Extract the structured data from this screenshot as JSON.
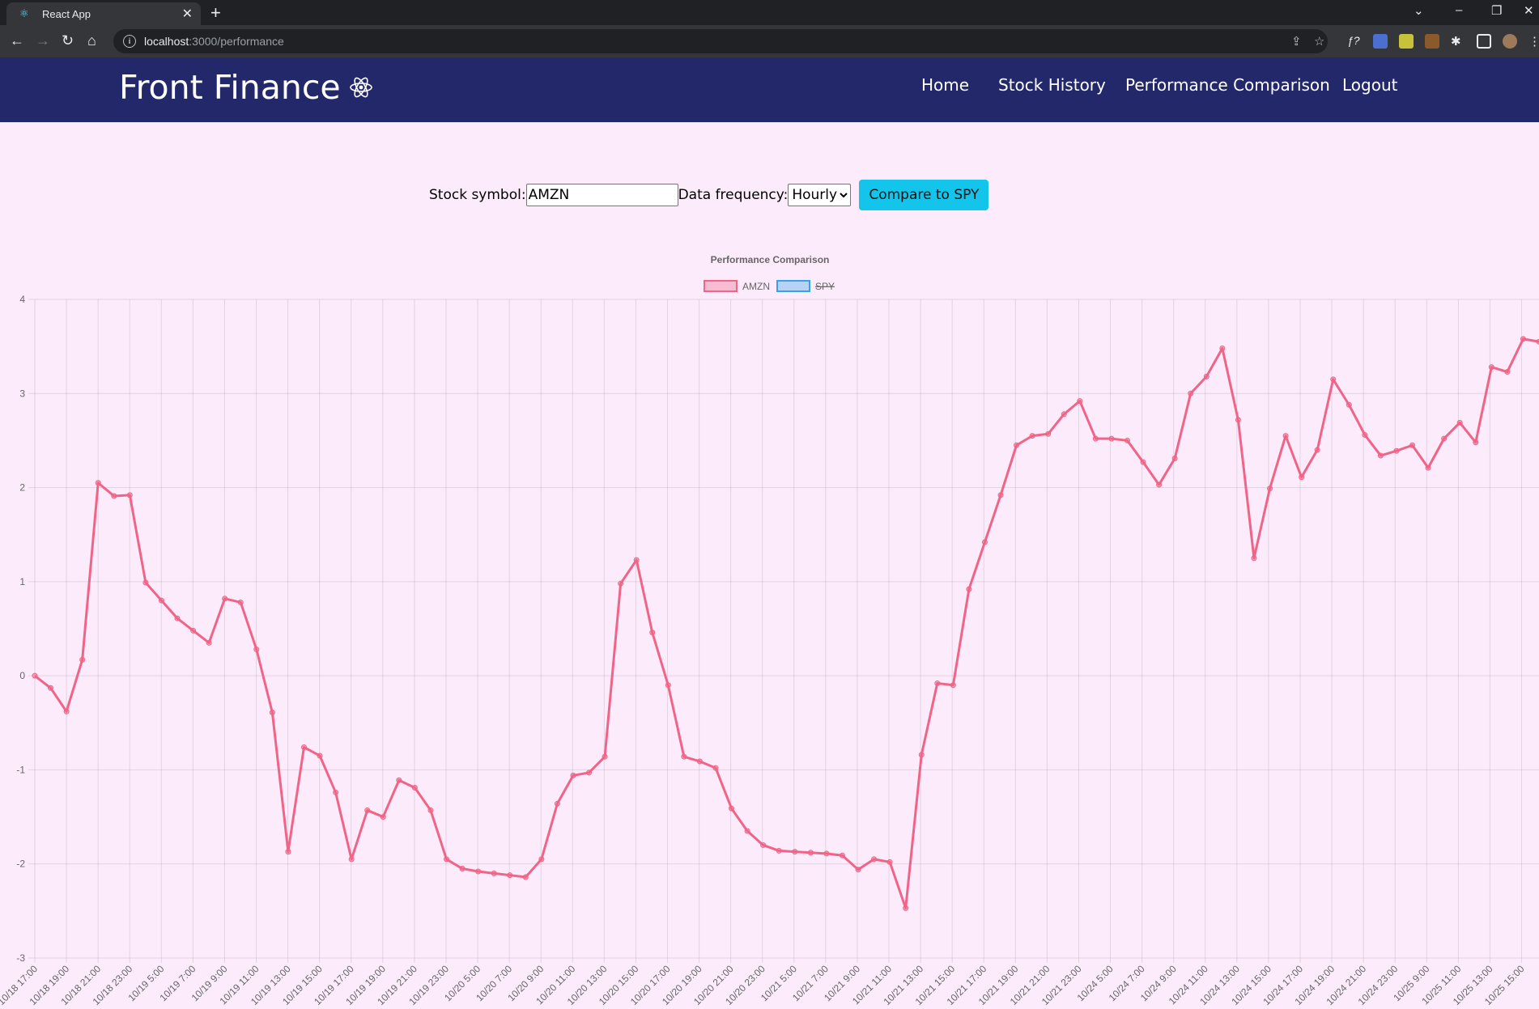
{
  "browser": {
    "tab_title": "React App",
    "url_host": "localhost",
    "url_rest": ":3000/performance"
  },
  "app": {
    "brand": "Front Finance",
    "nav": [
      "Home",
      "Stock History",
      "Performance Comparison",
      "Logout"
    ]
  },
  "form": {
    "symbol_label": "Stock symbol:",
    "symbol_value": "AMZN",
    "frequency_label": "Data frequency:",
    "frequency_selected": "Hourly",
    "compare_button": "Compare to SPY"
  },
  "colors": {
    "header_bg": "#23286b",
    "page_bg": "#fcebfb",
    "button_bg": "#13c5ea",
    "amzn_line": "#f06487",
    "spy_line": "#36a2eb"
  },
  "chart_data": {
    "type": "line",
    "title": "Performance Comparison",
    "legend": "top-center",
    "grid": true,
    "ylim": [
      -3,
      4
    ],
    "yticks": [
      -3,
      -2,
      -1,
      0,
      1,
      2,
      3,
      4
    ],
    "series": [
      {
        "name": "AMZN",
        "hidden": false,
        "values": [
          0,
          -0.13,
          -0.38,
          0.17,
          2.05,
          1.91,
          1.92,
          0.99,
          0.8,
          0.61,
          0.48,
          0.35,
          0.82,
          0.78,
          0.28,
          -0.39,
          -1.87,
          -0.76,
          -0.85,
          -1.24,
          -1.95,
          -1.43,
          -1.5,
          -1.11,
          -1.19,
          -1.43,
          -1.95,
          -2.05,
          -2.08,
          -2.1,
          -2.12,
          -2.14,
          -1.95,
          -1.36,
          -1.06,
          -1.03,
          -0.86,
          0.98,
          1.23,
          0.46,
          -0.1,
          -0.86,
          -0.91,
          -0.98,
          -1.41,
          -1.65,
          -1.8,
          -1.86,
          -1.87,
          -1.88,
          -1.89,
          -1.91,
          -2.06,
          -1.95,
          -1.98,
          -2.47,
          -0.84,
          -0.08,
          -0.1,
          0.92,
          1.42,
          1.92,
          2.45,
          2.55,
          2.57,
          2.78,
          2.92,
          2.52,
          2.52,
          2.5,
          2.27,
          2.03,
          2.31,
          3.0,
          3.18,
          3.48,
          2.72,
          1.25,
          1.99,
          2.55,
          2.11,
          2.4,
          3.15,
          2.88,
          2.56,
          2.34,
          2.39,
          2.45,
          2.21,
          2.52,
          2.69,
          2.48,
          3.28,
          3.23,
          3.58,
          3.55
        ]
      },
      {
        "name": "SPY",
        "hidden": true,
        "values": []
      }
    ],
    "x_tick_labels": [
      "10/18 17:00",
      "10/18 19:00",
      "10/18 21:00",
      "10/18 23:00",
      "10/19 5:00",
      "10/19 7:00",
      "10/19 9:00",
      "10/19 11:00",
      "10/19 13:00",
      "10/19 15:00",
      "10/19 17:00",
      "10/19 19:00",
      "10/19 21:00",
      "10/19 23:00",
      "10/20 5:00",
      "10/20 7:00",
      "10/20 9:00",
      "10/20 11:00",
      "10/20 13:00",
      "10/20 15:00",
      "10/20 17:00",
      "10/20 19:00",
      "10/20 21:00",
      "10/20 23:00",
      "10/21 5:00",
      "10/21 7:00",
      "10/21 9:00",
      "10/21 11:00",
      "10/21 13:00",
      "10/21 15:00",
      "10/21 17:00",
      "10/21 19:00",
      "10/21 21:00",
      "10/21 23:00",
      "10/24 5:00",
      "10/24 7:00",
      "10/24 9:00",
      "10/24 11:00",
      "10/24 13:00",
      "10/24 15:00",
      "10/24 17:00",
      "10/24 19:00",
      "10/24 21:00",
      "10/24 23:00",
      "10/25 9:00",
      "10/25 11:00",
      "10/25 13:00",
      "10/25 15:00"
    ]
  }
}
